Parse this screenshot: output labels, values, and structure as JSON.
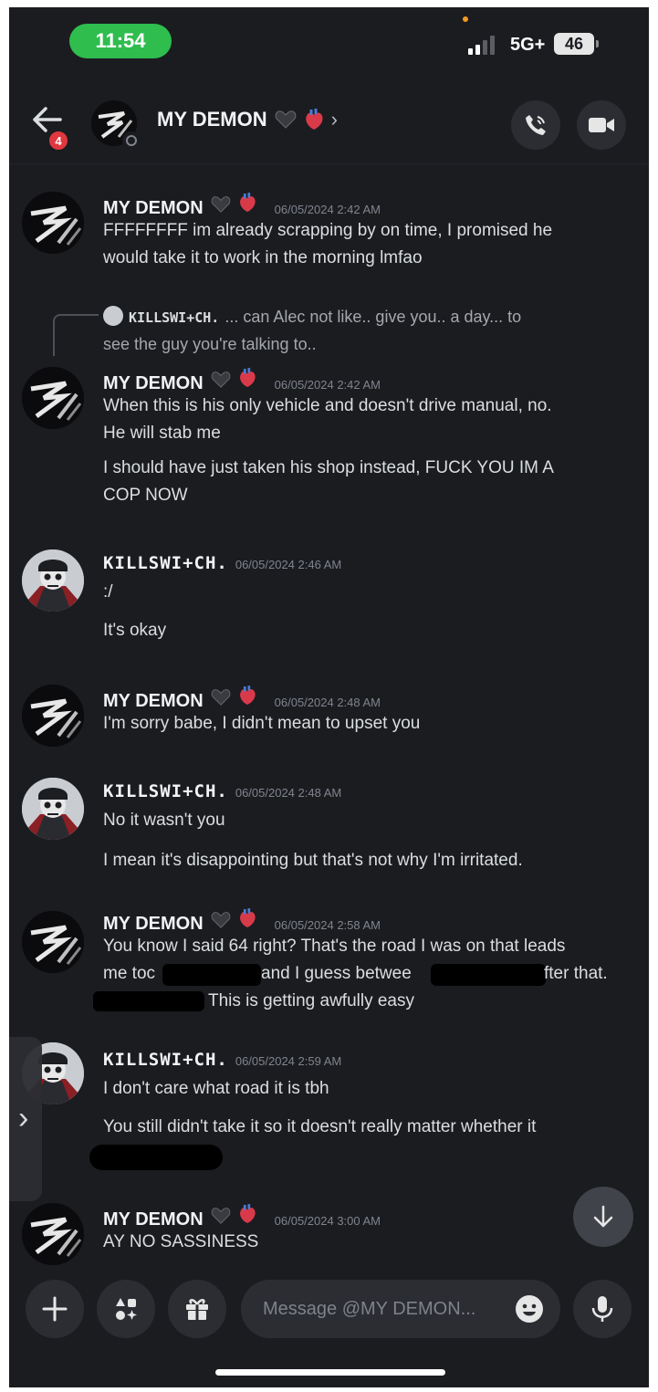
{
  "status_bar": {
    "time": "11:54",
    "network": "5G+",
    "battery": "46"
  },
  "header": {
    "back_badge": "4",
    "title": "MY DEMON",
    "chevron": "›"
  },
  "messages": [
    {
      "author": "MY DEMON",
      "timestamp": "06/05/2024 2:42 AM",
      "lines": [
        "FFFFFFFF im already scrapping by on time, I promised he",
        "would take it to work in the morning lmfao"
      ]
    },
    {
      "reply": {
        "author": "KILLSWI+CH.",
        "text": "... can Alec not like.. give you.. a day... to",
        "text2": "see the guy you're talking to.."
      },
      "author": "MY DEMON",
      "timestamp": "06/05/2024 2:42 AM",
      "lines": [
        "When this is his only vehicle and doesn't drive manual, no.",
        "He will stab me",
        "I should have just taken his shop instead, FUCK YOU IM A",
        "COP NOW"
      ]
    },
    {
      "author": "KILLSWI+CH.",
      "timestamp": "06/05/2024 2:46 AM",
      "lines": [
        ":/",
        "It's okay"
      ]
    },
    {
      "author": "MY DEMON",
      "timestamp": "06/05/2024 2:48 AM",
      "lines": [
        "I'm sorry babe, I didn't mean to upset you"
      ]
    },
    {
      "author": "KILLSWI+CH.",
      "timestamp": "06/05/2024 2:48 AM",
      "lines": [
        "No it wasn't you",
        "I mean it's disappointing but that's not why I'm irritated."
      ]
    },
    {
      "author": "MY DEMON",
      "timestamp": "06/05/2024 2:58 AM",
      "lines": [
        "You know I said 64 right? That's the road I was on that leads",
        "me toc",
        "and I guess betwee",
        "fter that.",
        "This is getting awfully easy"
      ]
    },
    {
      "author": "KILLSWI+CH.",
      "timestamp": "06/05/2024 2:59 AM",
      "lines": [
        "I don't care what road it is tbh",
        "You still didn't take it so it doesn't really matter whether it"
      ]
    },
    {
      "author": "MY DEMON",
      "timestamp": "06/05/2024 3:00 AM",
      "lines": [
        "AY NO SASSINESS"
      ]
    }
  ],
  "composer": {
    "placeholder": "Message @MY DEMON..."
  },
  "colors": {
    "background": "#1b1c20",
    "status_pill": "#2fbd4e",
    "badge": "#e0383e",
    "button": "#2b2d33"
  },
  "icons": [
    "back-arrow-icon",
    "call-icon",
    "video-icon",
    "plus-icon",
    "apps-icon",
    "gift-icon",
    "emoji-icon",
    "mic-icon",
    "arrow-down-icon",
    "chevron-right-icon"
  ]
}
